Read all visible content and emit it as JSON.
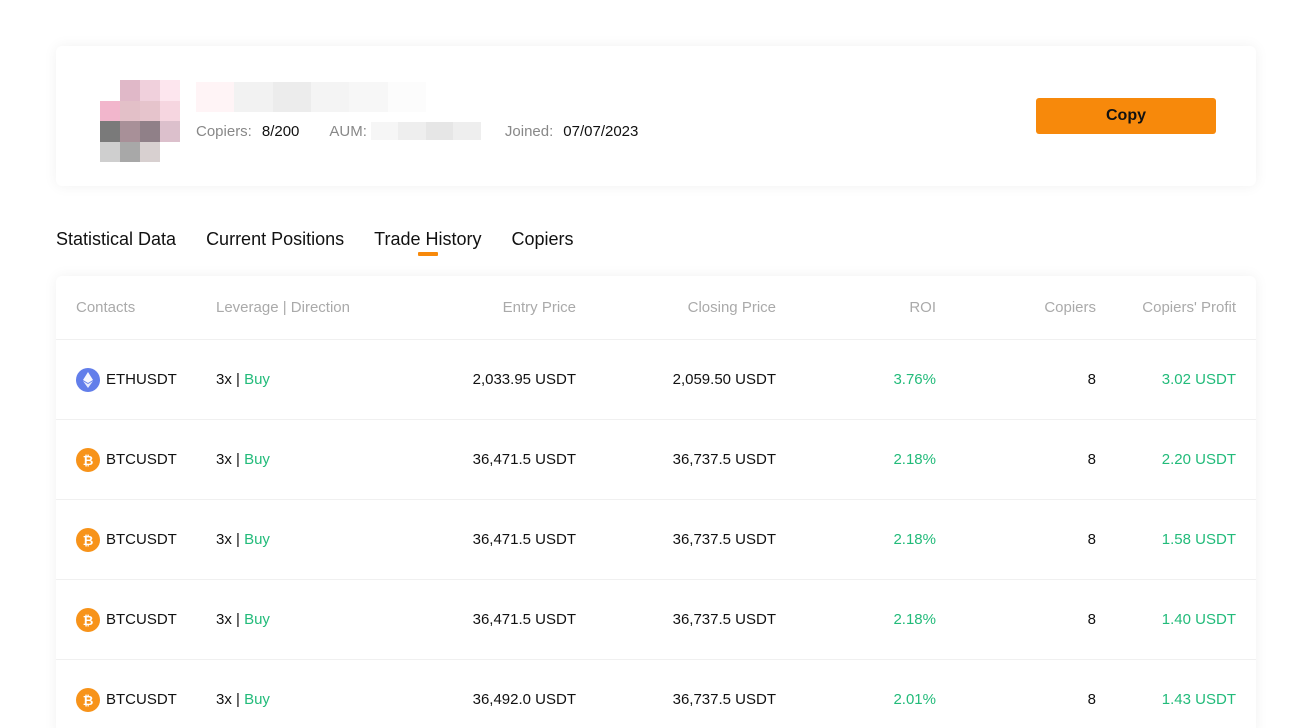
{
  "profile": {
    "copiers_label": "Copiers:",
    "copiers_value": "8/200",
    "aum_label": "AUM:",
    "joined_label": "Joined:",
    "joined_value": "07/07/2023",
    "copy_label": "Copy",
    "accent_color": "#f7890b"
  },
  "tabs": [
    {
      "label": "Statistical Data",
      "active": false
    },
    {
      "label": "Current Positions",
      "active": false
    },
    {
      "label": "Trade History",
      "active": true
    },
    {
      "label": "Copiers",
      "active": false
    }
  ],
  "table": {
    "headers": [
      "Contacts",
      "Leverage | Direction",
      "Entry Price",
      "Closing Price",
      "ROI",
      "Copiers",
      "Copiers' Profit"
    ],
    "rows": [
      {
        "icon": "ethereum-icon",
        "symbol": "ETHUSDT",
        "leverage": "3x |",
        "direction": "Buy",
        "entry": "2,033.95 USDT",
        "closing": "2,059.50 USDT",
        "roi": "3.76%",
        "copiers": "8",
        "profit": "3.02 USDT"
      },
      {
        "icon": "bitcoin-icon",
        "symbol": "BTCUSDT",
        "leverage": "3x |",
        "direction": "Buy",
        "entry": "36,471.5 USDT",
        "closing": "36,737.5 USDT",
        "roi": "2.18%",
        "copiers": "8",
        "profit": "2.20 USDT"
      },
      {
        "icon": "bitcoin-icon",
        "symbol": "BTCUSDT",
        "leverage": "3x |",
        "direction": "Buy",
        "entry": "36,471.5 USDT",
        "closing": "36,737.5 USDT",
        "roi": "2.18%",
        "copiers": "8",
        "profit": "1.58 USDT"
      },
      {
        "icon": "bitcoin-icon",
        "symbol": "BTCUSDT",
        "leverage": "3x |",
        "direction": "Buy",
        "entry": "36,471.5 USDT",
        "closing": "36,737.5 USDT",
        "roi": "2.18%",
        "copiers": "8",
        "profit": "1.40 USDT"
      },
      {
        "icon": "bitcoin-icon",
        "symbol": "BTCUSDT",
        "leverage": "3x |",
        "direction": "Buy",
        "entry": "36,492.0 USDT",
        "closing": "36,737.5 USDT",
        "roi": "2.01%",
        "copiers": "8",
        "profit": "1.43 USDT"
      }
    ]
  },
  "colors": {
    "positive": "#22bb7a",
    "ethereum": "#627eea",
    "bitcoin": "#f7931a"
  }
}
